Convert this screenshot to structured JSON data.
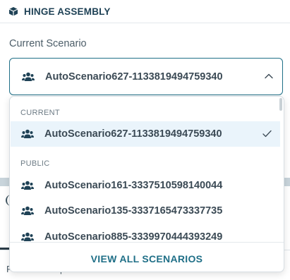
{
  "header": {
    "title": "HINGE ASSEMBLY",
    "icon": "cube-icon"
  },
  "scenario": {
    "label": "Current Scenario",
    "selected_value": "AutoScenario627-1133819494759340",
    "icon": "users-icon"
  },
  "dropdown": {
    "groups": [
      {
        "label": "CURRENT",
        "options": [
          {
            "label": "AutoScenario627-1133819494759340",
            "selected": true
          }
        ]
      },
      {
        "label": "PUBLIC",
        "options": [
          {
            "label": "AutoScenario161-3337510598140044"
          },
          {
            "label": "AutoScenario135-3337165473337735"
          },
          {
            "label": "AutoScenario885-3339970444393249"
          }
        ]
      }
    ],
    "view_all_label": "VIEW ALL SCENARIOS"
  },
  "background": {
    "fragment_left": "P",
    "fragment_right": "p"
  },
  "colors": {
    "accent": "#1f6f87",
    "selected_bg": "#eaf4fb",
    "header_text": "#1f4256"
  }
}
